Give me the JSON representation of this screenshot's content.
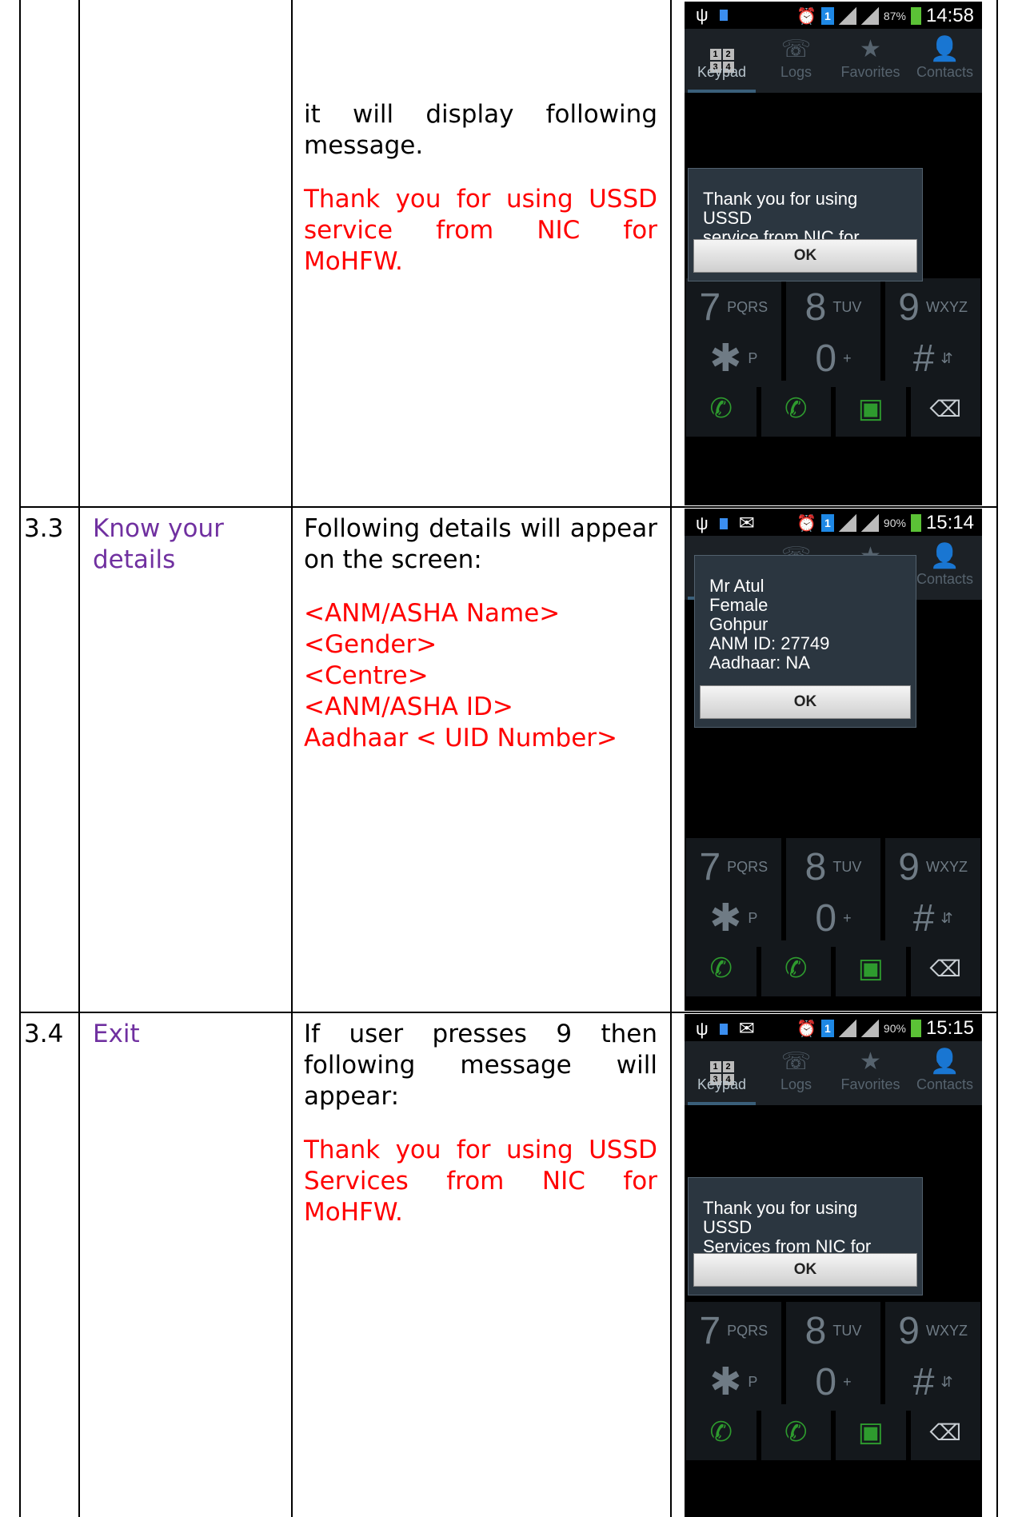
{
  "rows": [
    {
      "number": "",
      "item": "",
      "description": "it will display following message.",
      "message_lines": [
        "Thank you for using USSD service from NIC for MoHFW."
      ],
      "phone": {
        "status_time": "14:58",
        "battery": "87%",
        "dialog_text": "Thank you for using USSD\nservice from NIC for MoHFW.",
        "ok_label": "OK"
      }
    },
    {
      "number": "3.3",
      "item": "Know your details",
      "description": "Following details will appear on the screen:",
      "message_lines": [
        "<ANM/ASHA Name>",
        "<Gender>",
        "<Centre>",
        "<ANM/ASHA ID>",
        "Aadhaar < UID Number>"
      ],
      "phone": {
        "status_time": "15:14",
        "battery": "90%",
        "dialog_text": "Mr Atul\nFemale\nGohpur\nANM ID: 27749\nAadhaar: NA",
        "ok_label": "OK"
      }
    },
    {
      "number": "3.4",
      "item": "Exit",
      "description": "If user presses 9 then following message will appear:",
      "message_lines": [
        "Thank you for using USSD Services from NIC for MoHFW."
      ],
      "phone": {
        "status_time": "15:15",
        "battery": "90%",
        "dialog_text": "Thank you for using USSD\nServices from NIC for MoHFW.",
        "ok_label": "OK"
      }
    }
  ],
  "tabs": [
    "Keypad",
    "Logs",
    "Favorites",
    "Contacts"
  ],
  "keys": {
    "row7": [
      {
        "big": "7",
        "small": "PQRS"
      },
      {
        "big": "8",
        "small": "TUV"
      },
      {
        "big": "9",
        "small": "WXYZ"
      }
    ],
    "row_star": [
      {
        "big": "✱",
        "small": "P"
      },
      {
        "big": "0",
        "small": "+"
      },
      {
        "big": "#",
        "small": "⇵"
      }
    ]
  },
  "colors": {
    "item_purple": "#7030a0",
    "message_red": "#ff0000"
  }
}
